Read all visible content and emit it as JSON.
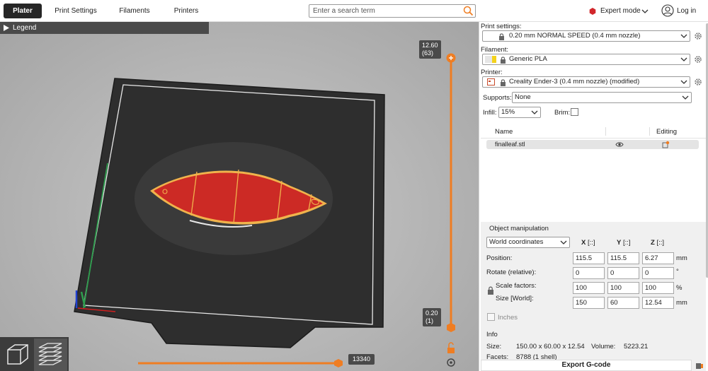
{
  "tabs": [
    {
      "label": "Plater",
      "active": true
    },
    {
      "label": "Print Settings"
    },
    {
      "label": "Filaments"
    },
    {
      "label": "Printers"
    }
  ],
  "search": {
    "placeholder": "Enter a search term"
  },
  "mode": {
    "label": "Expert mode",
    "color": "#d1262b"
  },
  "login": {
    "label": "Log in"
  },
  "legend": {
    "label": "Legend"
  },
  "vslider": {
    "top_value": "12.60",
    "top_layer": "(63)",
    "bottom_value": "0.20",
    "bottom_layer": "(1)"
  },
  "hslider": {
    "value": "13340"
  },
  "panel": {
    "print_settings": {
      "label": "Print settings:",
      "value": "0.20 mm NORMAL SPEED (0.4 mm nozzle)"
    },
    "filament": {
      "label": "Filament:",
      "value": "Generic PLA",
      "swatch": "#f4d21c"
    },
    "printer": {
      "label": "Printer:",
      "value": "Creality Ender-3 (0.4 mm nozzle) (modified)"
    },
    "supports": {
      "label": "Supports:",
      "value": "None"
    },
    "infill": {
      "label": "Infill:",
      "value": "15%"
    },
    "brim": {
      "label": "Brim:"
    },
    "table": {
      "name_col": "Name",
      "editing_col": "Editing"
    },
    "objects": [
      {
        "name": "finalleaf.stl"
      }
    ]
  },
  "object_manipulation": {
    "title": "Object manipulation",
    "coord_system": "World coordinates",
    "axes": [
      "X",
      "Y",
      "Z"
    ],
    "position": {
      "label": "Position:",
      "values": [
        "115.5",
        "115.5",
        "6.27"
      ],
      "unit": "mm"
    },
    "rotate": {
      "label": "Rotate (relative):",
      "values": [
        "0",
        "0",
        "0"
      ],
      "unit": "°"
    },
    "scale": {
      "label": "Scale factors:",
      "values": [
        "100",
        "100",
        "100"
      ],
      "unit": "%"
    },
    "size": {
      "label": "Size [World]:",
      "values": [
        "150",
        "60",
        "12.54"
      ],
      "unit": "mm"
    },
    "inches_label": "Inches"
  },
  "info": {
    "title": "Info",
    "size_label": "Size:",
    "size_value": "150.00 x 60.00 x 12.54",
    "volume_label": "Volume:",
    "volume_value": "5223.21",
    "facets_label": "Facets:",
    "facets_value": "8788 (1 shell)"
  },
  "export_label": "Export G-code",
  "colors": {
    "accent": "#ef7d22",
    "dark": "#262626",
    "part_red": "#cc2a25",
    "part_edge": "#f0b34c"
  }
}
